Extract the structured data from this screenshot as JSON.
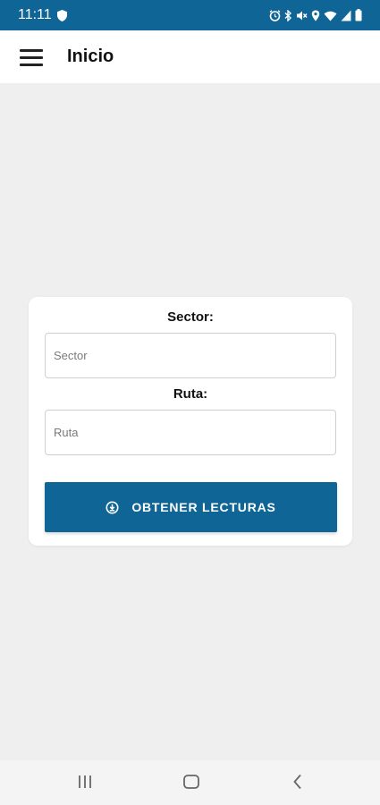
{
  "status_bar": {
    "time": "11:11",
    "background": "#0f6596"
  },
  "app_bar": {
    "title": "Inicio",
    "menu_icon": "hamburger-menu-icon"
  },
  "form": {
    "sector_label": "Sector:",
    "sector_placeholder": "Sector",
    "sector_value": "",
    "ruta_label": "Ruta:",
    "ruta_placeholder": "Ruta",
    "ruta_value": "",
    "submit_label": "OBTENER LECTURAS",
    "submit_icon": "download-circle-icon",
    "accent": "#0f6596"
  },
  "nav_bar": {
    "recents_icon": "recents-icon",
    "home_icon": "home-icon",
    "back_icon": "back-icon"
  }
}
